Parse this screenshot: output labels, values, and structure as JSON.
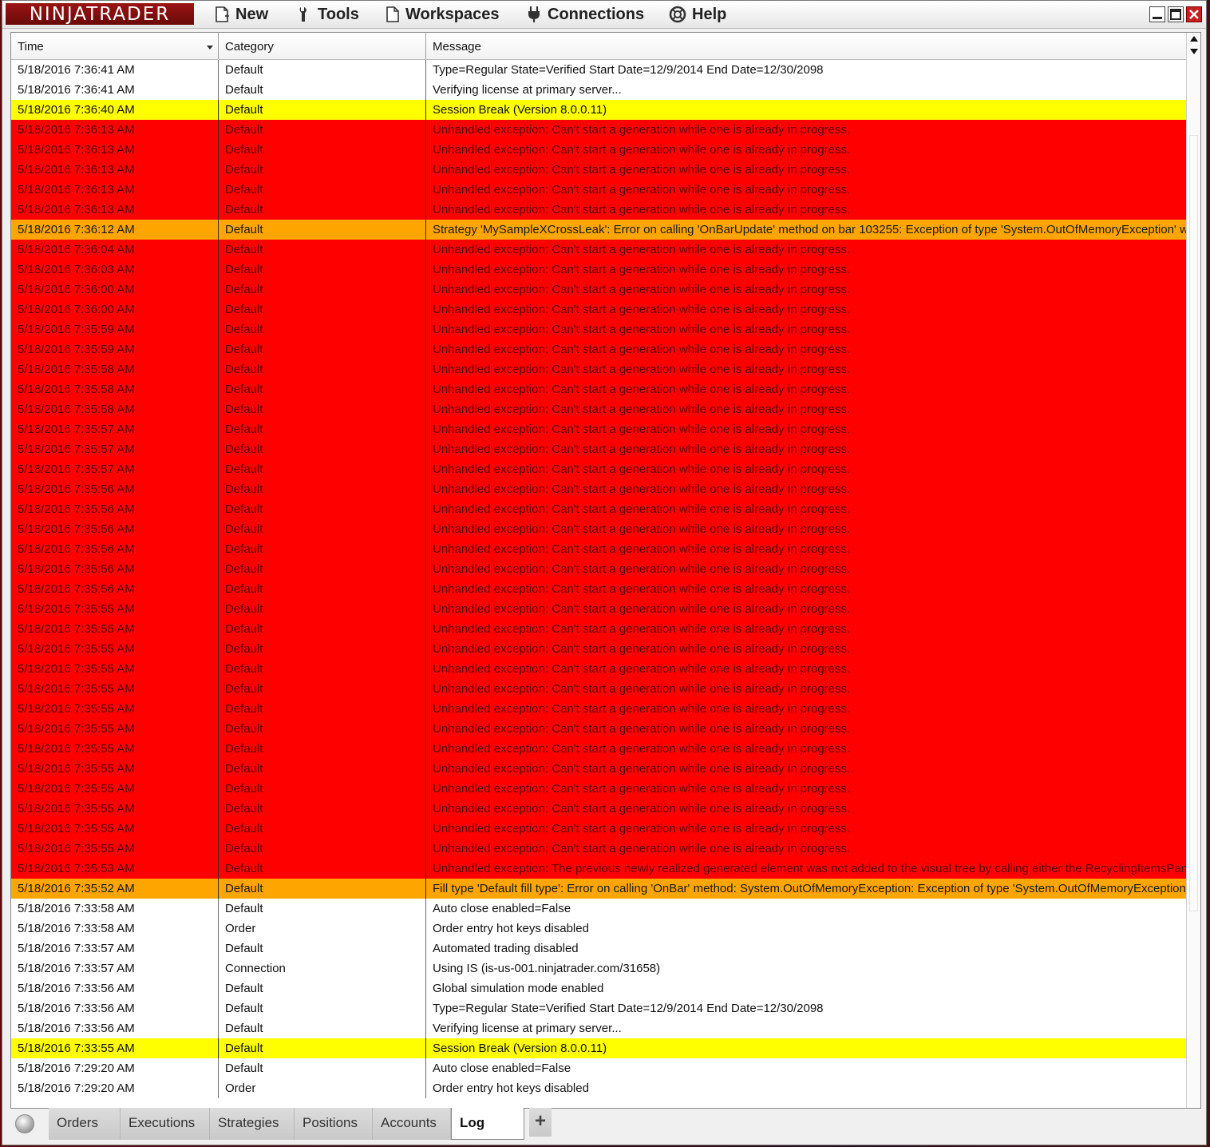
{
  "app": {
    "brand": "NINJATRADER"
  },
  "menu": {
    "new": "New",
    "tools": "Tools",
    "workspaces": "Workspaces",
    "connections": "Connections",
    "help": "Help"
  },
  "columns": {
    "time": "Time",
    "category": "Category",
    "message": "Message"
  },
  "colors": {
    "white": "#ffffff",
    "yellow": "#ffff00",
    "red": "#ff0000",
    "orange": "#ffa500"
  },
  "rows": [
    {
      "time": "5/18/2016 7:36:41 AM",
      "category": "Default",
      "message": "Type=Regular State=Verified Start Date=12/9/2014 End Date=12/30/2098",
      "level": "white"
    },
    {
      "time": "5/18/2016 7:36:41 AM",
      "category": "Default",
      "message": "Verifying license at primary server...",
      "level": "white"
    },
    {
      "time": "5/18/2016 7:36:40 AM",
      "category": "Default",
      "message": "Session Break (Version 8.0.0.11)",
      "level": "yellow"
    },
    {
      "time": "5/18/2016 7:36:13 AM",
      "category": "Default",
      "message": "Unhandled exception: Can't start a generation while one is already in progress.",
      "level": "red"
    },
    {
      "time": "5/18/2016 7:36:13 AM",
      "category": "Default",
      "message": "Unhandled exception: Can't start a generation while one is already in progress.",
      "level": "red"
    },
    {
      "time": "5/18/2016 7:36:13 AM",
      "category": "Default",
      "message": "Unhandled exception: Can't start a generation while one is already in progress.",
      "level": "red"
    },
    {
      "time": "5/18/2016 7:36:13 AM",
      "category": "Default",
      "message": "Unhandled exception: Can't start a generation while one is already in progress.",
      "level": "red"
    },
    {
      "time": "5/18/2016 7:36:13 AM",
      "category": "Default",
      "message": "Unhandled exception: Can't start a generation while one is already in progress.",
      "level": "red"
    },
    {
      "time": "5/18/2016 7:36:12 AM",
      "category": "Default",
      "message": "Strategy 'MySampleXCrossLeak': Error on calling 'OnBarUpdate' method on bar 103255: Exception of type 'System.OutOfMemoryException' was",
      "level": "orange"
    },
    {
      "time": "5/18/2016 7:36:04 AM",
      "category": "Default",
      "message": "Unhandled exception: Can't start a generation while one is already in progress.",
      "level": "red"
    },
    {
      "time": "5/18/2016 7:36:03 AM",
      "category": "Default",
      "message": "Unhandled exception: Can't start a generation while one is already in progress.",
      "level": "red"
    },
    {
      "time": "5/18/2016 7:36:00 AM",
      "category": "Default",
      "message": "Unhandled exception: Can't start a generation while one is already in progress.",
      "level": "red"
    },
    {
      "time": "5/18/2016 7:36:00 AM",
      "category": "Default",
      "message": "Unhandled exception: Can't start a generation while one is already in progress.",
      "level": "red"
    },
    {
      "time": "5/18/2016 7:35:59 AM",
      "category": "Default",
      "message": "Unhandled exception: Can't start a generation while one is already in progress.",
      "level": "red"
    },
    {
      "time": "5/18/2016 7:35:59 AM",
      "category": "Default",
      "message": "Unhandled exception: Can't start a generation while one is already in progress.",
      "level": "red"
    },
    {
      "time": "5/18/2016 7:35:58 AM",
      "category": "Default",
      "message": "Unhandled exception: Can't start a generation while one is already in progress.",
      "level": "red"
    },
    {
      "time": "5/18/2016 7:35:58 AM",
      "category": "Default",
      "message": "Unhandled exception: Can't start a generation while one is already in progress.",
      "level": "red"
    },
    {
      "time": "5/18/2016 7:35:58 AM",
      "category": "Default",
      "message": "Unhandled exception: Can't start a generation while one is already in progress.",
      "level": "red"
    },
    {
      "time": "5/18/2016 7:35:57 AM",
      "category": "Default",
      "message": "Unhandled exception: Can't start a generation while one is already in progress.",
      "level": "red"
    },
    {
      "time": "5/18/2016 7:35:57 AM",
      "category": "Default",
      "message": "Unhandled exception: Can't start a generation while one is already in progress.",
      "level": "red"
    },
    {
      "time": "5/18/2016 7:35:57 AM",
      "category": "Default",
      "message": "Unhandled exception: Can't start a generation while one is already in progress.",
      "level": "red"
    },
    {
      "time": "5/18/2016 7:35:56 AM",
      "category": "Default",
      "message": "Unhandled exception: Can't start a generation while one is already in progress.",
      "level": "red"
    },
    {
      "time": "5/18/2016 7:35:56 AM",
      "category": "Default",
      "message": "Unhandled exception: Can't start a generation while one is already in progress.",
      "level": "red"
    },
    {
      "time": "5/18/2016 7:35:56 AM",
      "category": "Default",
      "message": "Unhandled exception: Can't start a generation while one is already in progress.",
      "level": "red"
    },
    {
      "time": "5/18/2016 7:35:56 AM",
      "category": "Default",
      "message": "Unhandled exception: Can't start a generation while one is already in progress.",
      "level": "red"
    },
    {
      "time": "5/18/2016 7:35:56 AM",
      "category": "Default",
      "message": "Unhandled exception: Can't start a generation while one is already in progress.",
      "level": "red"
    },
    {
      "time": "5/18/2016 7:35:56 AM",
      "category": "Default",
      "message": "Unhandled exception: Can't start a generation while one is already in progress.",
      "level": "red"
    },
    {
      "time": "5/18/2016 7:35:55 AM",
      "category": "Default",
      "message": "Unhandled exception: Can't start a generation while one is already in progress.",
      "level": "red"
    },
    {
      "time": "5/18/2016 7:35:55 AM",
      "category": "Default",
      "message": "Unhandled exception: Can't start a generation while one is already in progress.",
      "level": "red"
    },
    {
      "time": "5/18/2016 7:35:55 AM",
      "category": "Default",
      "message": "Unhandled exception: Can't start a generation while one is already in progress.",
      "level": "red"
    },
    {
      "time": "5/18/2016 7:35:55 AM",
      "category": "Default",
      "message": "Unhandled exception: Can't start a generation while one is already in progress.",
      "level": "red"
    },
    {
      "time": "5/18/2016 7:35:55 AM",
      "category": "Default",
      "message": "Unhandled exception: Can't start a generation while one is already in progress.",
      "level": "red"
    },
    {
      "time": "5/18/2016 7:35:55 AM",
      "category": "Default",
      "message": "Unhandled exception: Can't start a generation while one is already in progress.",
      "level": "red"
    },
    {
      "time": "5/18/2016 7:35:55 AM",
      "category": "Default",
      "message": "Unhandled exception: Can't start a generation while one is already in progress.",
      "level": "red"
    },
    {
      "time": "5/18/2016 7:35:55 AM",
      "category": "Default",
      "message": "Unhandled exception: Can't start a generation while one is already in progress.",
      "level": "red"
    },
    {
      "time": "5/18/2016 7:35:55 AM",
      "category": "Default",
      "message": "Unhandled exception: Can't start a generation while one is already in progress.",
      "level": "red"
    },
    {
      "time": "5/18/2016 7:35:55 AM",
      "category": "Default",
      "message": "Unhandled exception: Can't start a generation while one is already in progress.",
      "level": "red"
    },
    {
      "time": "5/18/2016 7:35:55 AM",
      "category": "Default",
      "message": "Unhandled exception: Can't start a generation while one is already in progress.",
      "level": "red"
    },
    {
      "time": "5/18/2016 7:35:55 AM",
      "category": "Default",
      "message": "Unhandled exception: Can't start a generation while one is already in progress.",
      "level": "red"
    },
    {
      "time": "5/18/2016 7:35:55 AM",
      "category": "Default",
      "message": "Unhandled exception: Can't start a generation while one is already in progress.",
      "level": "red"
    },
    {
      "time": "5/18/2016 7:35:53 AM",
      "category": "Default",
      "message": "Unhandled exception: The previous newly realized generated element was not added to the visual tree by calling either the RecyclingItemsPanel's",
      "level": "red"
    },
    {
      "time": "5/18/2016 7:35:52 AM",
      "category": "Default",
      "message": "Fill type 'Default fill type': Error on calling 'OnBar' method: System.OutOfMemoryException: Exception of type 'System.OutOfMemoryException' w",
      "level": "orange"
    },
    {
      "time": "5/18/2016 7:33:58 AM",
      "category": "Default",
      "message": "Auto close enabled=False",
      "level": "white"
    },
    {
      "time": "5/18/2016 7:33:58 AM",
      "category": "Order",
      "message": "Order entry hot keys disabled",
      "level": "white"
    },
    {
      "time": "5/18/2016 7:33:57 AM",
      "category": "Default",
      "message": "Automated trading disabled",
      "level": "white"
    },
    {
      "time": "5/18/2016 7:33:57 AM",
      "category": "Connection",
      "message": "Using IS (is-us-001.ninjatrader.com/31658)",
      "level": "white"
    },
    {
      "time": "5/18/2016 7:33:56 AM",
      "category": "Default",
      "message": "Global simulation mode enabled",
      "level": "white"
    },
    {
      "time": "5/18/2016 7:33:56 AM",
      "category": "Default",
      "message": "Type=Regular State=Verified Start Date=12/9/2014 End Date=12/30/2098",
      "level": "white"
    },
    {
      "time": "5/18/2016 7:33:56 AM",
      "category": "Default",
      "message": "Verifying license at primary server...",
      "level": "white"
    },
    {
      "time": "5/18/2016 7:33:55 AM",
      "category": "Default",
      "message": "Session Break (Version 8.0.0.11)",
      "level": "yellow"
    },
    {
      "time": "5/18/2016 7:29:20 AM",
      "category": "Default",
      "message": "Auto close enabled=False",
      "level": "white"
    },
    {
      "time": "5/18/2016 7:29:20 AM",
      "category": "Order",
      "message": "Order entry hot keys disabled",
      "level": "white"
    }
  ],
  "tabs": [
    {
      "label": "Orders",
      "active": false
    },
    {
      "label": "Executions",
      "active": false
    },
    {
      "label": "Strategies",
      "active": false
    },
    {
      "label": "Positions",
      "active": false
    },
    {
      "label": "Accounts",
      "active": false
    },
    {
      "label": "Log",
      "active": true
    }
  ],
  "add_tab_label": "+"
}
